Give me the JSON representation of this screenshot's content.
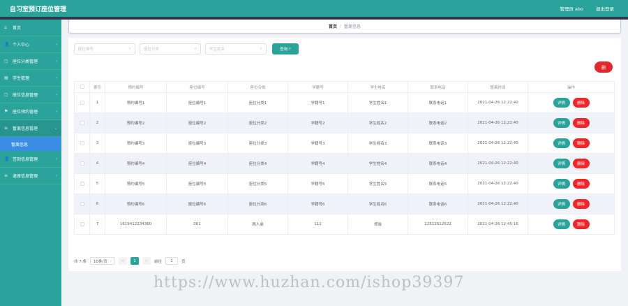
{
  "header": {
    "title": "自习室预订座位管理",
    "user": "管理员 abo",
    "logout": "退出登录"
  },
  "sidebar": {
    "items": [
      {
        "icon": "home-icon",
        "label": "首页",
        "glyph": "⌂"
      },
      {
        "icon": "user-icon",
        "label": "个人中心",
        "glyph": "👤"
      },
      {
        "icon": "grid-icon",
        "label": "座位分类管理",
        "glyph": "▢"
      },
      {
        "icon": "doc-icon",
        "label": "学生管理",
        "glyph": "▤"
      },
      {
        "icon": "grid-icon",
        "label": "座位信息管理",
        "glyph": "▢"
      },
      {
        "icon": "flag-icon",
        "label": "座位预约管理",
        "glyph": "⚑"
      },
      {
        "icon": "list-icon",
        "label": "暂离信息管理",
        "glyph": "≡"
      },
      {
        "icon": "user-icon",
        "label": "签到信息管理",
        "glyph": "👤"
      },
      {
        "icon": "list-icon",
        "label": "退座信息管理",
        "glyph": "≡"
      }
    ],
    "sub_item": "暂离信息"
  },
  "breadcrumb": {
    "home": "首页",
    "sep": "/",
    "current": "暂离信息"
  },
  "search": {
    "seat_no_placeholder": "座位编号",
    "category_placeholder": "座位分类",
    "student_name_placeholder": "学生姓名",
    "button": "查询"
  },
  "actions": {
    "delete_top": "删"
  },
  "table": {
    "headers": [
      "",
      "索引",
      "预约编号",
      "座位编号",
      "座位分类",
      "学籍号",
      "学生姓名",
      "联系电话",
      "暂离时间",
      "操作"
    ],
    "rows": [
      {
        "index": "1",
        "booking_no": "预约编号1",
        "seat_no": "座位编号1",
        "category": "座位分类1",
        "student_id": "学籍号1",
        "name": "学生姓名1",
        "phone": "联系电话1",
        "time": "2021-04-26 12:22:40"
      },
      {
        "index": "2",
        "booking_no": "预约编号2",
        "seat_no": "座位编号2",
        "category": "座位分类2",
        "student_id": "学籍号2",
        "name": "学生姓名2",
        "phone": "联系电话2",
        "time": "2021-04-26 12:22:40"
      },
      {
        "index": "3",
        "booking_no": "预约编号3",
        "seat_no": "座位编号3",
        "category": "座位分类3",
        "student_id": "学籍号3",
        "name": "学生姓名3",
        "phone": "联系电话3",
        "time": "2021-04-26 12:22:40"
      },
      {
        "index": "4",
        "booking_no": "预约编号4",
        "seat_no": "座位编号4",
        "category": "座位分类4",
        "student_id": "学籍号4",
        "name": "学生姓名4",
        "phone": "联系电话4",
        "time": "2021-04-26 12:22:40"
      },
      {
        "index": "5",
        "booking_no": "预约编号5",
        "seat_no": "座位编号5",
        "category": "座位分类5",
        "student_id": "学籍号5",
        "name": "学生姓名5",
        "phone": "联系电话5",
        "time": "2021-04-26 12:22:40"
      },
      {
        "index": "6",
        "booking_no": "预约编号6",
        "seat_no": "座位编号6",
        "category": "座位分类6",
        "student_id": "学籍号6",
        "name": "学生姓名6",
        "phone": "联系电话6",
        "time": "2021-04-26 12:22:40"
      },
      {
        "index": "7",
        "booking_no": "1619412234360",
        "seat_no": "001",
        "category": "两人桌",
        "student_id": "111",
        "name": "郑晓",
        "phone": "12512512522",
        "time": "2021-04-26 12:45:16"
      }
    ],
    "detail_label": "详情",
    "delete_label": "删除"
  },
  "pagination": {
    "total": "共 7 条",
    "page_size": "10条/页",
    "prev": "<",
    "current_page": "1",
    "next": ">",
    "goto_label": "前往",
    "goto_value": "1",
    "page_suffix": "页"
  },
  "watermark": "https://www.huzhan.com/ishop39397",
  "colors": {
    "primary": "#2aa39a",
    "danger": "#e0282f",
    "submenu": "#3a8ee6"
  }
}
